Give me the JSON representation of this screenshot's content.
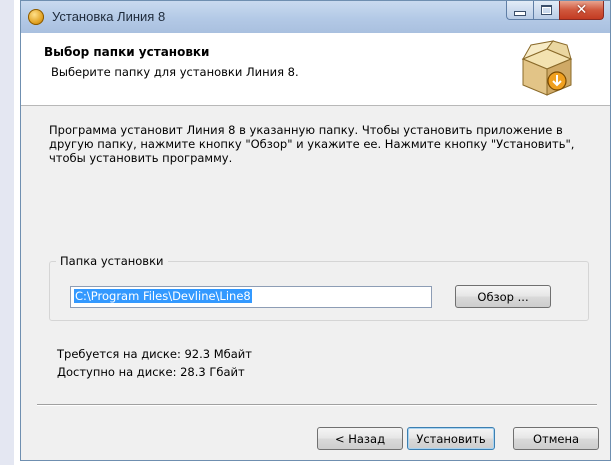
{
  "window": {
    "title": "Установка Линия 8"
  },
  "header": {
    "title": "Выбор папки установки",
    "subtitle": "Выберите папку для установки Линия 8."
  },
  "description": "Программа установит Линия 8 в указанную папку. Чтобы установить приложение в другую папку, нажмите кнопку \"Обзор\" и укажите ее. Нажмите кнопку \"Установить\", чтобы установить программу.",
  "folder_group": {
    "label": "Папка установки",
    "path_value": "C:\\Program Files\\Devline\\Line8",
    "browse_label": "Обзор ..."
  },
  "disk_info": {
    "required": "Требуется на диске: 92.3 Мбайт",
    "available": "Доступно на диске: 28.3 Гбайт"
  },
  "buttons": {
    "back": "< Назад",
    "install": "Установить",
    "cancel": "Отмена"
  },
  "icons": {
    "app": "installer-disc-icon",
    "header": "box-install-icon",
    "close": "close-icon",
    "minimize": "minimize-icon",
    "maximize": "maximize-icon"
  },
  "colors": {
    "titlebar": "#b3c9e6",
    "close_button": "#d0583d",
    "selection": "#3399ff",
    "dialog_bg": "#f0f0f0"
  }
}
